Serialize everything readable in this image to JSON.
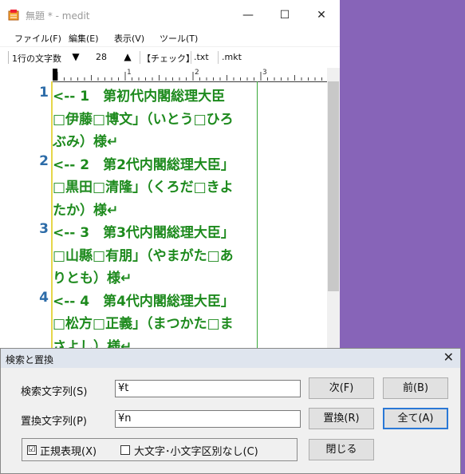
{
  "window": {
    "title": "無題 * - medit",
    "minimize": "—",
    "maximize": "☐",
    "close": "✕"
  },
  "menu": {
    "file": "ファイル(F)",
    "edit": "編集(E)",
    "view": "表示(V)",
    "tools": "ツール(T)"
  },
  "toolbar": {
    "chars_per_line_label": "1行の文字数",
    "down_arrow": "▼",
    "width_value": "28",
    "up_arrow": "▲",
    "check": "【チェック】",
    "txt": ".txt",
    "mkt": ".mkt"
  },
  "ruler": {
    "marks": [
      "1",
      "2",
      "3"
    ]
  },
  "editor": {
    "line_numbers": [
      {
        "num": "1",
        "row": 0
      },
      {
        "num": "2",
        "row": 3
      },
      {
        "num": "3",
        "row": 6
      },
      {
        "num": "4",
        "row": 9
      }
    ],
    "rows": [
      "<-- 1　第初代内閣総理大臣　",
      "□伊藤□博文」（いとう□ひろ",
      "ぶみ）様↵",
      "<-- 2　第2代内閣総理大臣」",
      "□黒田□清隆」（くろだ□きよ",
      "たか）様↵",
      "<-- 3　第3代内閣総理大臣」",
      "□山縣□有朋」（やまがた□あ",
      "りとも）様↵",
      "<-- 4　第4代内閣総理大臣」",
      "□松方□正義」（まつかた□ま",
      "さよし）様↵"
    ]
  },
  "dialog": {
    "title": "検索と置換",
    "close": "✕",
    "search_label": "検索文字列(S)",
    "search_value": "¥t",
    "replace_label": "置換文字列(P)",
    "replace_value": "¥n",
    "next_button": "次(F)",
    "prev_button": "前(B)",
    "replace_button": "置換(R)",
    "replace_all_button": "全て(A)",
    "close_button": "閉じる",
    "regex_label": "正規表現(X)",
    "regex_checked": "☑",
    "ignore_case_label": "大文字･小文字区別なし(C)"
  },
  "colors": {
    "text": "#1d8a1d",
    "line_numbers": "#2d6ca8",
    "desktop": "#8764b8"
  }
}
